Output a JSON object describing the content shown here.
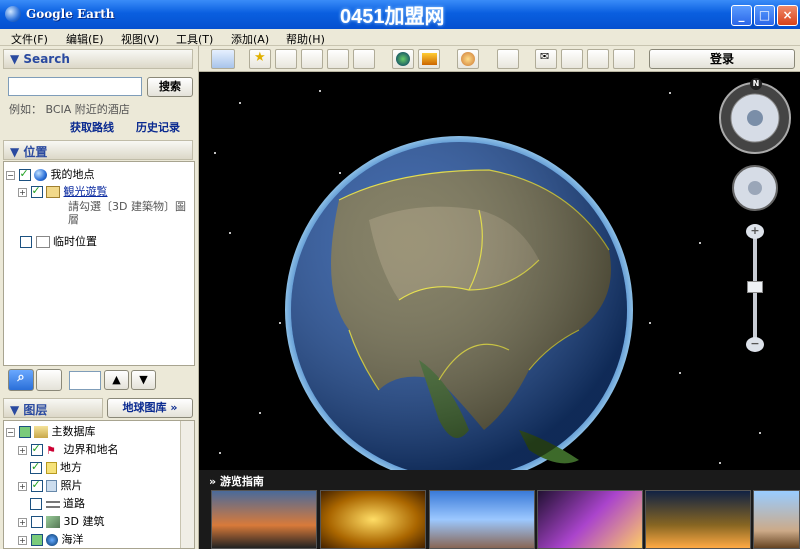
{
  "window": {
    "title": "Google Earth",
    "watermark": "0451加盟网",
    "minimize": "_",
    "maximize": "□",
    "close": "×"
  },
  "menu": [
    "文件(F)",
    "编辑(E)",
    "视图(V)",
    "工具(T)",
    "添加(A)",
    "帮助(H)"
  ],
  "search": {
    "header": "Search",
    "button": "搜索",
    "example": "例如：  BCIA 附近的酒店",
    "directions": "获取路线",
    "history": "历史记录"
  },
  "places": {
    "header": "位置",
    "my_places": "我的地点",
    "sightseeing": "観光遊覧",
    "sightseeing_desc_1": "請勾選〔3D 建築物〕圖",
    "sightseeing_desc_2": "層",
    "temp_places": "临时位置"
  },
  "nav": {
    "up": "▲",
    "down": "▼"
  },
  "layers": {
    "header": "图层",
    "gallery": "地球图库 »",
    "items": [
      "主数据库",
      "边界和地名",
      "地方",
      "照片",
      "道路",
      "3D 建筑",
      "海洋"
    ]
  },
  "toolbar": {
    "login": "登录"
  },
  "compass": {
    "north": "N"
  },
  "zoom": {
    "plus": "+",
    "minus": "−"
  },
  "tour": {
    "header": "游览指南"
  },
  "colors": {
    "titlebar": "#0a5fe0",
    "panel": "#ece9d8",
    "link": "#0a2a90",
    "border_yellow": "#f0e830"
  }
}
